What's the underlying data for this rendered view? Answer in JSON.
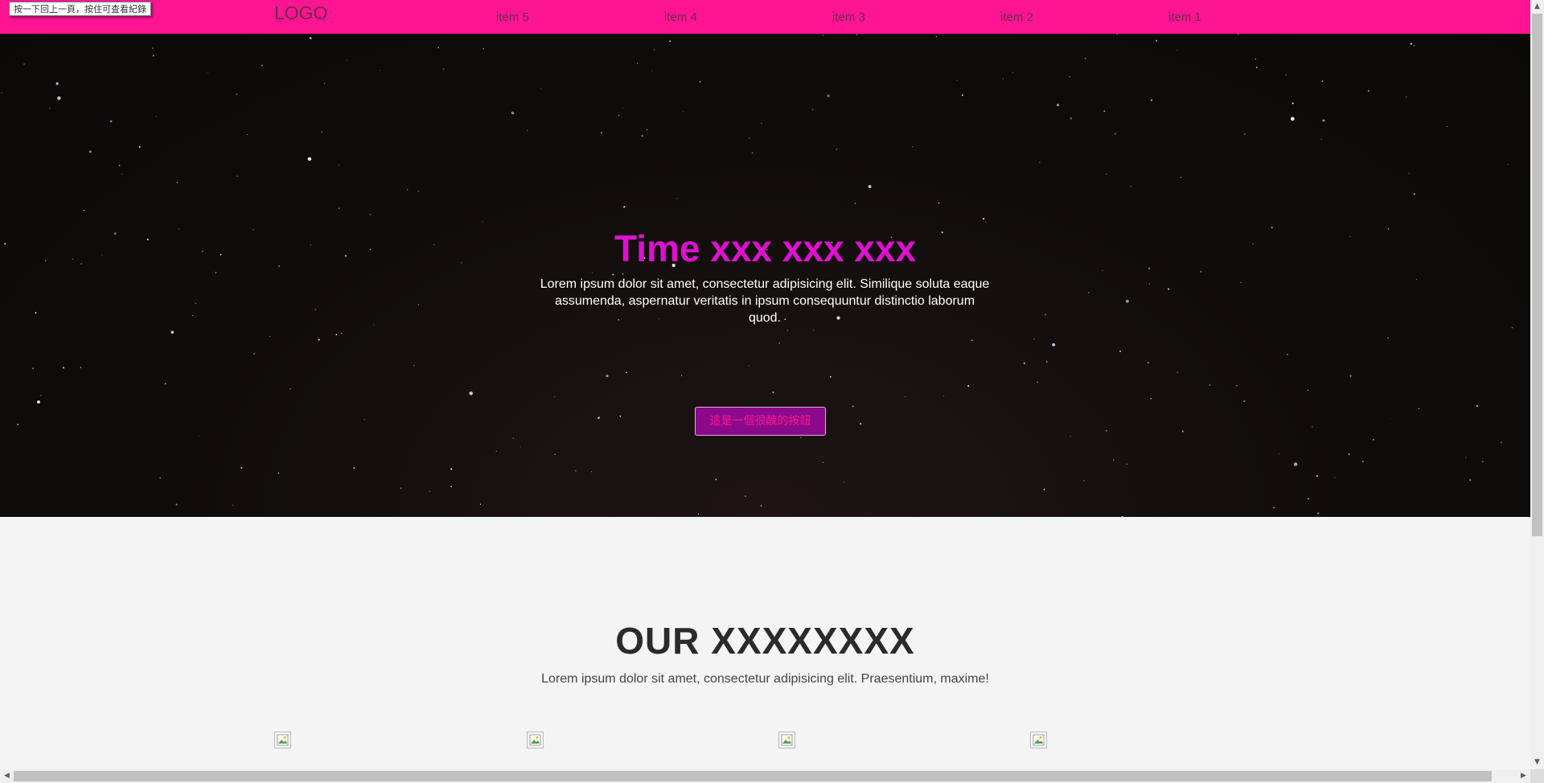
{
  "tooltip": {
    "text": "按一下回上一頁，按住可查看紀錄"
  },
  "navbar": {
    "logo": "LOGO",
    "items": [
      {
        "label": "item 5"
      },
      {
        "label": "item 4"
      },
      {
        "label": "item 3"
      },
      {
        "label": "item 2"
      },
      {
        "label": "item 1"
      }
    ],
    "bg_color": "#ff1493"
  },
  "hero": {
    "title": "Time xxx xxx xxx",
    "text": "Lorem ipsum dolor sit amet, consectetur adipisicing elit. Similique soluta eaque assumenda, aspernatur veritatis in ipsum consequuntur distinctio laborum quod.",
    "button_label": "這是一個很醜的按鈕",
    "title_color": "#e00fd2"
  },
  "section": {
    "title": "OUR XXXXXXXX",
    "text": "Lorem ipsum dolor sit amet, consectetur adipisicing elit. Praesentium, maxime!",
    "images": [
      {
        "icon": "broken-image-icon"
      },
      {
        "icon": "broken-image-icon"
      },
      {
        "icon": "broken-image-icon"
      },
      {
        "icon": "broken-image-icon"
      }
    ]
  }
}
